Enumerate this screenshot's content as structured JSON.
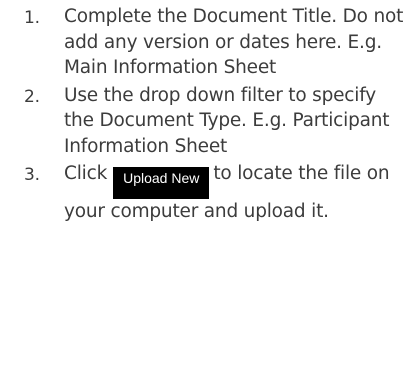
{
  "steps": [
    {
      "number": "1.",
      "text": "Complete the Document Title. Do not add any version or dates here. E.g. Main Information Sheet"
    },
    {
      "number": "2.",
      "text": "Use the drop down filter to specify the Document Type. E.g. Participant Information Sheet"
    },
    {
      "number": "3.",
      "text_before": "Click",
      "button_label": "Upload New",
      "text_after": "to locate the file on your computer and upload it."
    }
  ]
}
